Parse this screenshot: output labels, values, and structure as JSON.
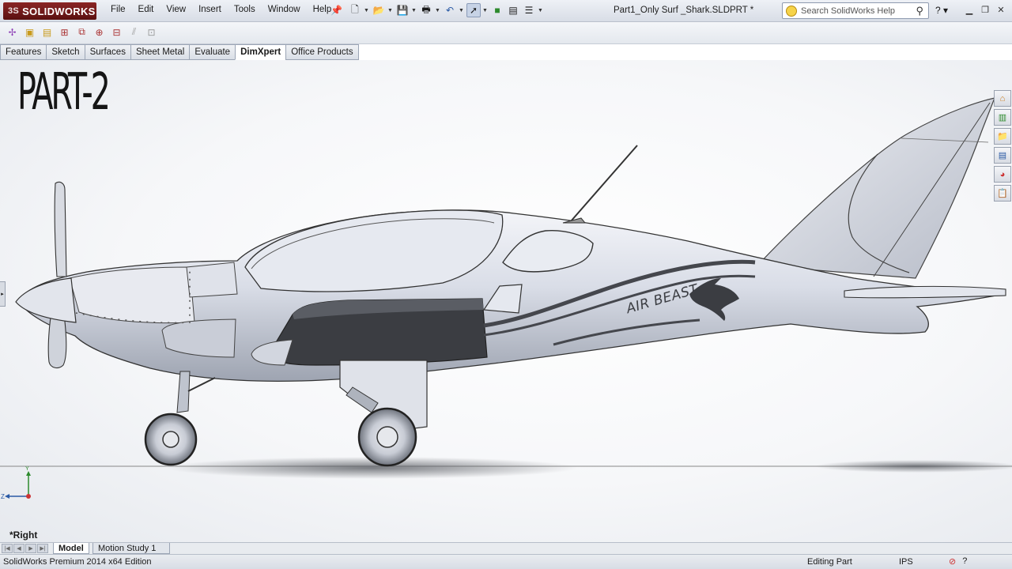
{
  "app": {
    "logo_text": "SOLIDWORKS",
    "logo_prefix": "3S",
    "document_title": "Part1_Only Surf _Shark.SLDPRT *"
  },
  "menu": [
    "File",
    "Edit",
    "View",
    "Insert",
    "Tools",
    "Window",
    "Help"
  ],
  "search": {
    "placeholder": "Search SolidWorks Help"
  },
  "tabs": [
    "Features",
    "Sketch",
    "Surfaces",
    "Sheet Metal",
    "Evaluate",
    "DimXpert",
    "Office Products"
  ],
  "active_tab": "DimXpert",
  "overlay_label": "PART-2",
  "model": {
    "decal_text": "AIR BEAST",
    "view_name": "*Right"
  },
  "triad": {
    "y": "Y",
    "z": "Z"
  },
  "bottom_tabs": [
    "Model",
    "Motion Study 1"
  ],
  "status": {
    "edition": "SolidWorks Premium 2014 x64 Edition",
    "mode": "Editing Part",
    "units": "IPS"
  },
  "colors": {
    "logo": "#7a1b1b",
    "body_surface": "#d9dde7",
    "dark_panel": "#3b3d42",
    "stripe": "#45474d"
  }
}
